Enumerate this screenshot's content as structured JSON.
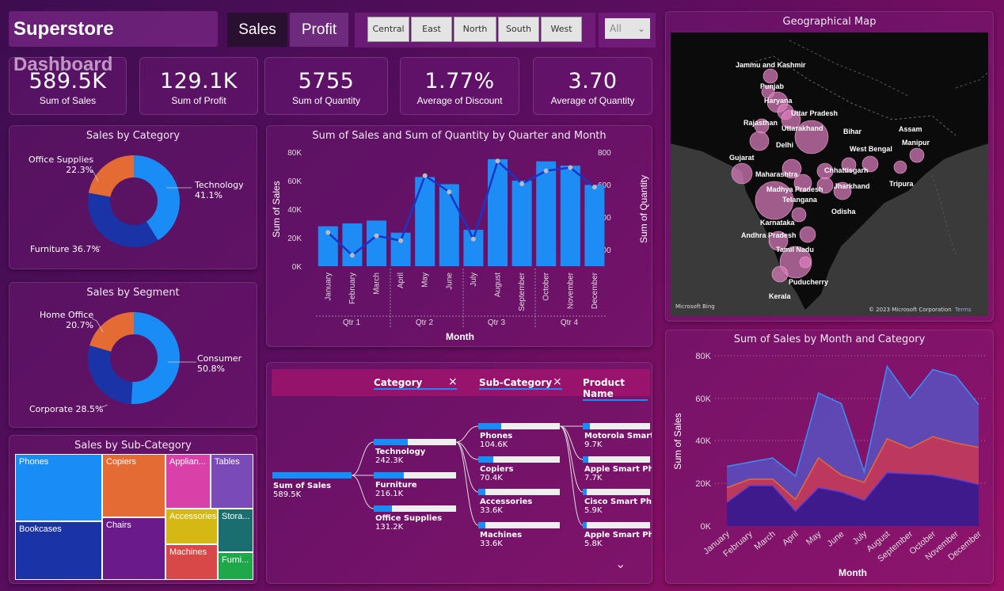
{
  "header": {
    "title": "Superstore Dashboard",
    "tab_sales": "Sales",
    "tab_profit": "Profit",
    "regions": [
      "Central",
      "East",
      "North",
      "South",
      "West"
    ],
    "dropdown_value": "All"
  },
  "kpis": [
    {
      "value": "589.5K",
      "label": "Sum of Sales"
    },
    {
      "value": "129.1K",
      "label": "Sum of Profit"
    },
    {
      "value": "5755",
      "label": "Sum of Quantity"
    },
    {
      "value": "1.77%",
      "label": "Average of Discount"
    },
    {
      "value": "3.70",
      "label": "Average of Quantity"
    }
  ],
  "category_title": "Sales by Category",
  "category_labels": {
    "office": "Office Supplies",
    "office_pct": "22.3%",
    "tech": "Technology",
    "tech_pct": "41.1%",
    "furniture": "Furniture 36.7%"
  },
  "segment_title": "Sales by Segment",
  "segment_labels": {
    "home": "Home Office",
    "home_pct": "20.7%",
    "consumer": "Consumer",
    "consumer_pct": "50.8%",
    "corporate": "Corporate 28.5%"
  },
  "subcat_title": "Sales by Sub-Category",
  "subcat": [
    "Phones",
    "Copiers",
    "Applian...",
    "Tables",
    "Bookcases",
    "Chairs",
    "Accessories",
    "Stora...",
    "Machines",
    "Furni..."
  ],
  "combo_title": "Sum of Sales and Sum of Quantity by Quarter and Month",
  "combo_axes": {
    "y_left": "Sum of Sales",
    "y_right": "Sum of Quantity",
    "x": "Month",
    "left_ticks": [
      "80K",
      "60K",
      "40K",
      "20K",
      "0K"
    ],
    "right_ticks": [
      "800",
      "600",
      "400",
      "200"
    ],
    "quarters": [
      "Qtr 1",
      "Qtr 2",
      "Qtr 3",
      "Qtr 4"
    ]
  },
  "map": {
    "title": "Geographical Map",
    "credit": "© 2023 Microsoft Corporation",
    "terms": "Terms",
    "brand": "Microsoft Bing",
    "labels": [
      "Jammu and Kashmir",
      "Punjab",
      "Haryana",
      "Uttar Pradesh",
      "Rajasthan",
      "Uttarakhand",
      "Bihar",
      "Assam",
      "Delhi",
      "Manipur",
      "West Bengal",
      "Gujarat",
      "Maharashtra",
      "Chhattisgarh",
      "Tripura",
      "Madhya Pradesh",
      "Jharkhand",
      "Telangana",
      "Odisha",
      "Karnataka",
      "Andhra Pradesh",
      "Tamil Nadu",
      "Puducherry",
      "Kerala"
    ]
  },
  "area_title": "Sum of Sales by Month and Category",
  "area_axes": {
    "y": "Sum of Sales",
    "x": "Month",
    "ticks": [
      "80K",
      "60K",
      "40K",
      "20K",
      "0K"
    ]
  },
  "tree": {
    "headers": [
      "Category",
      "Sub-Category",
      "Product Name"
    ],
    "root": {
      "label": "Sum of Sales",
      "value": "589.5K"
    },
    "cat": [
      {
        "label": "Technology",
        "value": "242.3K"
      },
      {
        "label": "Furniture",
        "value": "216.1K"
      },
      {
        "label": "Office Supplies",
        "value": "131.2K"
      }
    ],
    "sub": [
      {
        "label": "Phones",
        "value": "104.6K"
      },
      {
        "label": "Copiers",
        "value": "70.4K"
      },
      {
        "label": "Accessories",
        "value": "33.6K"
      },
      {
        "label": "Machines",
        "value": "33.6K"
      }
    ],
    "prod": [
      {
        "label": "Motorola Smart",
        "value": "9.7K"
      },
      {
        "label": "Apple Smart Ph",
        "value": "7.7K"
      },
      {
        "label": "Cisco Smart Pho",
        "value": "5.9K"
      },
      {
        "label": "Apple Smart Ph",
        "value": "5.8K"
      }
    ]
  },
  "chart_data": [
    {
      "type": "bar",
      "title": "Sum of Sales and Sum of Quantity by Quarter and Month",
      "categories": [
        "January",
        "February",
        "March",
        "April",
        "May",
        "June",
        "July",
        "August",
        "September",
        "October",
        "November",
        "December"
      ],
      "series": [
        {
          "name": "Sum of Sales",
          "values": [
            28000,
            30000,
            32000,
            23500,
            62500,
            57500,
            25500,
            75000,
            60000,
            73500,
            70500,
            57000
          ]
        },
        {
          "name": "Sum of Quantity",
          "type": "line",
          "values": [
            300,
            160,
            280,
            250,
            650,
            550,
            260,
            740,
            600,
            680,
            700,
            580
          ]
        }
      ],
      "ylim": [
        0,
        80000
      ],
      "y2lim": [
        0,
        800
      ],
      "xlabel": "Month",
      "ylabel": "Sum of Sales",
      "y2label": "Sum of Quantity"
    },
    {
      "type": "area",
      "title": "Sum of Sales by Month and Category",
      "categories": [
        "January",
        "February",
        "March",
        "April",
        "May",
        "June",
        "July",
        "August",
        "September",
        "October",
        "November",
        "December"
      ],
      "series": [
        {
          "name": "Furniture",
          "values": [
            11000,
            19000,
            19000,
            7000,
            18000,
            16000,
            12000,
            25000,
            24500,
            24000,
            22000,
            19500
          ]
        },
        {
          "name": "Office Supplies",
          "values": [
            7000,
            3000,
            3000,
            5500,
            14000,
            8000,
            8500,
            16000,
            12000,
            18000,
            17000,
            17500
          ]
        },
        {
          "name": "Technology",
          "values": [
            10000,
            8000,
            10000,
            11000,
            30500,
            33500,
            5000,
            34000,
            23500,
            31500,
            31500,
            20000
          ]
        }
      ],
      "ylim": [
        0,
        80000
      ],
      "xlabel": "Month",
      "ylabel": "Sum of Sales"
    },
    {
      "type": "pie",
      "title": "Sales by Category",
      "categories": [
        "Technology",
        "Furniture",
        "Office Supplies"
      ],
      "values": [
        41.1,
        36.7,
        22.3
      ]
    },
    {
      "type": "pie",
      "title": "Sales by Segment",
      "categories": [
        "Consumer",
        "Corporate",
        "Home Office"
      ],
      "values": [
        50.8,
        28.5,
        20.7
      ]
    }
  ],
  "colors": {
    "blue": "#1e8cf5",
    "darkblue": "#1a34a8",
    "orange": "#e56b34",
    "purple": "#5a2a9e"
  }
}
